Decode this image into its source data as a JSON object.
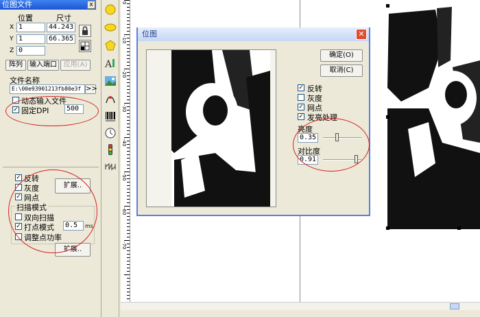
{
  "panel": {
    "title": "位图文件",
    "close_label": "x",
    "pos_header": "位置",
    "size_header": "尺寸",
    "x_label": "X",
    "y_label": "Y",
    "z_label": "Z",
    "x_value": "1",
    "y_value": "1",
    "z_value": "0",
    "w_value": "44.243",
    "h_value": "66.365",
    "array_btn": "阵列",
    "input_port_btn": "输入端口",
    "apply_btn": "应用(A)",
    "file_name_label": "文件名称",
    "file_path": "E:\\00e93901213fb80e3f",
    "browse_btn": ">>",
    "dynamic_input": "动态输入文件",
    "fixed_dpi": "固定DPI",
    "dpi_value": "500",
    "invert": "反转",
    "grayscale": "灰度",
    "dither": "网点",
    "expand_btn_1": "扩展..",
    "scan_mode_label": "扫描模式",
    "bidirectional": "双向扫描",
    "dot_mode": "打点模式",
    "dot_value": "0.5",
    "dot_unit": "ms",
    "adjust_power": "调整点功率",
    "expand_btn_2": "扩展.."
  },
  "checks": {
    "dynamic_input": false,
    "fixed_dpi": true,
    "invert": true,
    "grayscale": false,
    "dither": true,
    "bidirectional": false,
    "dot_mode": true,
    "adjust_power": false
  },
  "dialog": {
    "title": "位图",
    "close_label": "✕",
    "ok_btn": "确定(O)",
    "cancel_btn": "取消(C)",
    "invert": "反转",
    "grayscale": "灰度",
    "dither": "网点",
    "enhance": "发亮处理",
    "brightness_label": "亮度",
    "brightness_value": "0.35",
    "contrast_label": "对比度",
    "contrast_value": "0.91"
  },
  "dialog_checks": {
    "invert": true,
    "grayscale": false,
    "dither": true,
    "enhance": true
  },
  "sliders": {
    "brightness": 0.35,
    "contrast": 0.91
  },
  "ruler": {
    "labels": [
      "0",
      "-10",
      "-20",
      "-30",
      "-40",
      "-50",
      "-60",
      "-70"
    ]
  },
  "toolbar": {
    "icons": [
      "circle-icon",
      "ellipse-icon",
      "polygon-icon",
      "text-icon",
      "bitmap-icon",
      "vector-file-icon",
      "barcode-icon",
      "timer-icon",
      "io-light-icon",
      "output-icon"
    ]
  },
  "colors": {
    "highlight_ring": "#d32020",
    "title_bar": "#1c55d6"
  }
}
